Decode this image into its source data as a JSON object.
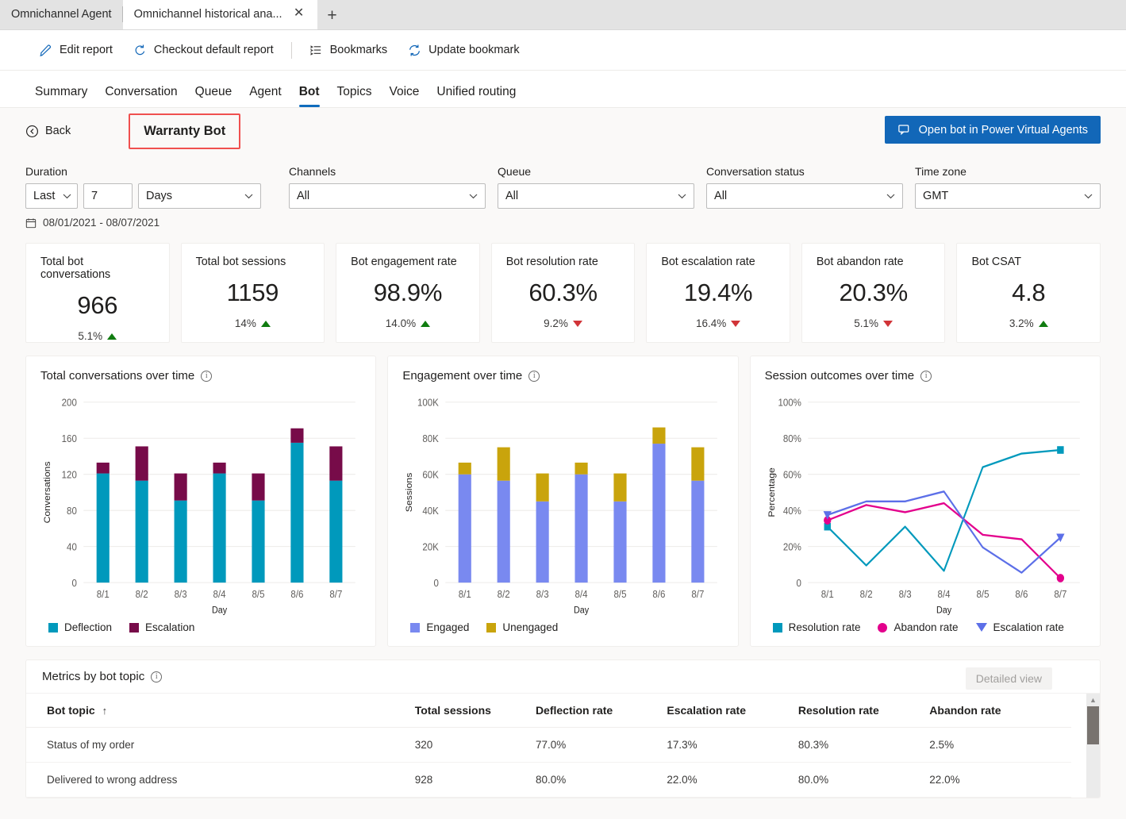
{
  "browser": {
    "tabs": [
      {
        "title": "Omnichannel Agent",
        "active": false
      },
      {
        "title": "Omnichannel historical ana...",
        "active": true
      }
    ],
    "close_glyph": "✕",
    "newtab_glyph": "+"
  },
  "commandbar": {
    "items": [
      {
        "label": "Edit report",
        "icon": "pencil-icon"
      },
      {
        "label": "Checkout default report",
        "icon": "refresh-icon"
      },
      {
        "label": "Bookmarks",
        "icon": "bookmark-list-icon"
      },
      {
        "label": "Update bookmark",
        "icon": "sync-icon"
      }
    ]
  },
  "navtabs": [
    {
      "label": "Summary",
      "selected": false
    },
    {
      "label": "Conversation",
      "selected": false
    },
    {
      "label": "Queue",
      "selected": false
    },
    {
      "label": "Agent",
      "selected": false
    },
    {
      "label": "Bot",
      "selected": true
    },
    {
      "label": "Topics",
      "selected": false
    },
    {
      "label": "Voice",
      "selected": false
    },
    {
      "label": "Unified routing",
      "selected": false
    }
  ],
  "subheader": {
    "back_label": "Back",
    "bot_name": "Warranty Bot",
    "open_bot_button": "Open bot in Power Virtual Agents",
    "highlight_color": "#f0504f",
    "button_color": "#1267b8"
  },
  "filters": {
    "duration": {
      "label": "Duration",
      "relative_value": "Last",
      "number_value": "7",
      "unit_value": "Days"
    },
    "channels": {
      "label": "Channels",
      "value": "All"
    },
    "queue": {
      "label": "Queue",
      "value": "All"
    },
    "conversation_status": {
      "label": "Conversation status",
      "value": "All"
    },
    "time_zone": {
      "label": "Time zone",
      "value": "GMT"
    },
    "date_range": "08/01/2021 - 08/07/2021"
  },
  "kpis": [
    {
      "title": "Total bot conversations",
      "value": "966",
      "delta": "5.1%",
      "direction": "up"
    },
    {
      "title": "Total bot sessions",
      "value": "1159",
      "delta": "14%",
      "direction": "up"
    },
    {
      "title": "Bot engagement rate",
      "value": "98.9%",
      "delta": "14.0%",
      "direction": "up"
    },
    {
      "title": "Bot resolution rate",
      "value": "60.3%",
      "delta": "9.2%",
      "direction": "down"
    },
    {
      "title": "Bot escalation rate",
      "value": "19.4%",
      "delta": "16.4%",
      "direction": "down"
    },
    {
      "title": "Bot abandon rate",
      "value": "20.3%",
      "delta": "5.1%",
      "direction": "down"
    },
    {
      "title": "Bot CSAT",
      "value": "4.8",
      "delta": "3.2%",
      "direction": "up"
    }
  ],
  "chart_data": [
    {
      "type": "bar",
      "stacked": true,
      "title": "Total conversations over time",
      "xlabel": "Day",
      "ylabel": "Conversations",
      "categories": [
        "8/1",
        "8/2",
        "8/3",
        "8/4",
        "8/5",
        "8/6",
        "8/7"
      ],
      "ylim": [
        0,
        200
      ],
      "yticks": [
        0,
        40,
        80,
        120,
        160,
        200
      ],
      "ytick_labels": [
        "0",
        "40",
        "80",
        "120",
        "160",
        "200"
      ],
      "grid": true,
      "legend_position": "bottom-left",
      "series": [
        {
          "name": "Deflection",
          "color": "#0099bc",
          "values": [
            121,
            113,
            91,
            121,
            91,
            155,
            113
          ]
        },
        {
          "name": "Escalation",
          "color": "#770b49",
          "values": [
            12,
            38,
            30,
            12,
            30,
            16,
            38
          ]
        }
      ]
    },
    {
      "type": "bar",
      "stacked": true,
      "title": "Engagement over time",
      "xlabel": "Day",
      "ylabel": "Sessions",
      "categories": [
        "8/1",
        "8/2",
        "8/3",
        "8/4",
        "8/5",
        "8/6",
        "8/7"
      ],
      "ylim": [
        0,
        100000
      ],
      "yticks": [
        0,
        20000,
        40000,
        60000,
        80000,
        100000
      ],
      "ytick_labels": [
        "0",
        "20K",
        "40K",
        "60K",
        "80K",
        "100K"
      ],
      "grid": true,
      "legend_position": "bottom-left",
      "series": [
        {
          "name": "Engaged",
          "color": "#7989f0",
          "values": [
            60000,
            56500,
            45000,
            60000,
            45000,
            77000,
            56500
          ]
        },
        {
          "name": "Unengaged",
          "color": "#c9a40c",
          "values": [
            6500,
            18500,
            15500,
            6500,
            15500,
            9000,
            18500
          ]
        }
      ]
    },
    {
      "type": "line",
      "title": "Session outcomes over time",
      "xlabel": "Day",
      "ylabel": "Percentage",
      "categories": [
        "8/1",
        "8/2",
        "8/3",
        "8/4",
        "8/5",
        "8/6",
        "8/7"
      ],
      "ylim": [
        0,
        100
      ],
      "yticks": [
        0,
        20,
        40,
        60,
        80,
        100
      ],
      "ytick_labels": [
        "0",
        "20%",
        "40%",
        "60%",
        "80%",
        "100%"
      ],
      "grid": true,
      "legend_position": "bottom-left",
      "series": [
        {
          "name": "Resolution rate",
          "color": "#0099bc",
          "marker": "square",
          "values": [
            31,
            9.5,
            31,
            6.5,
            64,
            71.5,
            73.5
          ]
        },
        {
          "name": "Abandon rate",
          "color": "#e3008c",
          "marker": "circle",
          "values": [
            34.5,
            43,
            39,
            44,
            26.5,
            24,
            2.5
          ]
        },
        {
          "name": "Escalation rate",
          "color": "#5c6fe8",
          "marker": "triangle",
          "values": [
            37.5,
            45,
            45,
            50.5,
            19.5,
            5.5,
            25
          ]
        }
      ]
    }
  ],
  "table": {
    "title": "Metrics by bot topic",
    "detailed_view_label": "Detailed view",
    "sort_column": "Bot topic",
    "sort_glyph": "↑",
    "columns": [
      "Bot topic",
      "Total sessions",
      "Deflection rate",
      "Escalation rate",
      "Resolution rate",
      "Abandon rate"
    ],
    "rows": [
      {
        "topic": "Status of my order",
        "total_sessions": "320",
        "deflection_rate": "77.0%",
        "escalation_rate": "17.3%",
        "resolution_rate": "80.3%",
        "abandon_rate": "2.5%"
      },
      {
        "topic": "Delivered to wrong address",
        "total_sessions": "928",
        "deflection_rate": "80.0%",
        "escalation_rate": "22.0%",
        "resolution_rate": "80.0%",
        "abandon_rate": "22.0%"
      }
    ]
  }
}
